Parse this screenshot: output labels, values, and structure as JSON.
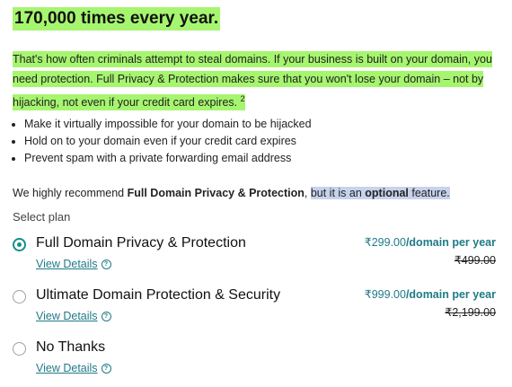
{
  "heading": "170,000 times every year.",
  "intro": {
    "text": "That's how often criminals attempt to steal domains. If your business is built on your domain, you need protection. Full Privacy & Protection makes sure that you won't lose your domain – not by hijacking, not even if your credit card expires.",
    "footnote": "2"
  },
  "bullets": [
    "Make it virtually impossible for your domain to be hijacked",
    "Hold on to your domain even if your credit card expires",
    "Prevent spam with a private forwarding email address"
  ],
  "recommend": {
    "prefix": "We highly recommend ",
    "product": "Full Domain Privacy & Protection",
    "comma": ", ",
    "mid": "but it is an ",
    "optional": "optional",
    "suffix": " feature."
  },
  "select_plan_label": "Select plan",
  "plans": [
    {
      "name": "Full Domain Privacy & Protection",
      "view_details": "View Details",
      "price": "₹299.00",
      "unit": "/domain per year",
      "old_price": "₹499.00",
      "selected": true
    },
    {
      "name": "Ultimate Domain Protection & Security",
      "view_details": "View Details",
      "price": "₹999.00",
      "unit": "/domain per year",
      "old_price": "₹2,199.00",
      "selected": false
    },
    {
      "name": "No Thanks",
      "view_details": "View Details",
      "selected": false
    }
  ],
  "colors": {
    "highlight_green": "#a6f56f",
    "highlight_blue": "#c7d3ec",
    "accent_teal": "#119089",
    "link": "#1f7a87"
  },
  "icons": {
    "info": "info-circle-icon"
  }
}
